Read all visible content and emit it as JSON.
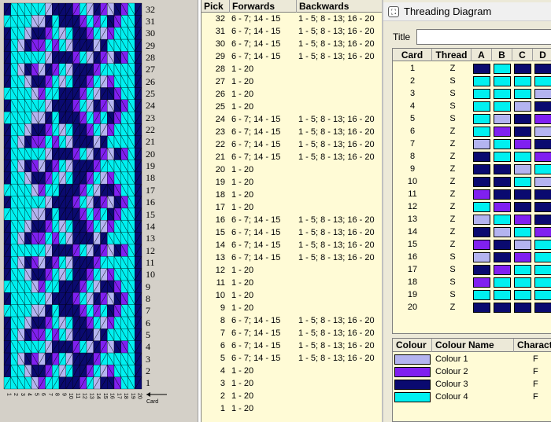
{
  "colours": [
    "#b4b4f0",
    "#8020f0",
    "#0a0a70",
    "#00f0f0"
  ],
  "pattern": {
    "pick_labels": [
      "32",
      "31",
      "30",
      "29",
      "28",
      "27",
      "26",
      "25",
      "24",
      "23",
      "22",
      "21",
      "20",
      "19",
      "18",
      "17",
      "16",
      "15",
      "14",
      "13",
      "12",
      "11",
      "10",
      "9",
      "8",
      "7",
      "6",
      "5",
      "4",
      "3",
      "2",
      "1"
    ],
    "card_labels": [
      "1",
      "2",
      "3",
      "4",
      "5",
      "6",
      "7",
      "8",
      "9",
      "10",
      "11",
      "12",
      "13",
      "14",
      "15",
      "16",
      "17",
      "18",
      "19",
      "20"
    ],
    "card_axis_label": "Card"
  },
  "pick_table": {
    "headers": {
      "pick": "Pick",
      "forwards": "Forwards",
      "backwards": "Backwards"
    },
    "rows": [
      {
        "pick": "32",
        "forwards": "6 - 7; 14 - 15",
        "backwards": "1 - 5; 8 - 13; 16 - 20"
      },
      {
        "pick": "31",
        "forwards": "6 - 7; 14 - 15",
        "backwards": "1 - 5; 8 - 13; 16 - 20"
      },
      {
        "pick": "30",
        "forwards": "6 - 7; 14 - 15",
        "backwards": "1 - 5; 8 - 13; 16 - 20"
      },
      {
        "pick": "29",
        "forwards": "6 - 7; 14 - 15",
        "backwards": "1 - 5; 8 - 13; 16 - 20"
      },
      {
        "pick": "28",
        "forwards": "1 - 20",
        "backwards": ""
      },
      {
        "pick": "27",
        "forwards": "1 - 20",
        "backwards": ""
      },
      {
        "pick": "26",
        "forwards": "1 - 20",
        "backwards": ""
      },
      {
        "pick": "25",
        "forwards": "1 - 20",
        "backwards": ""
      },
      {
        "pick": "24",
        "forwards": "6 - 7; 14 - 15",
        "backwards": "1 - 5; 8 - 13; 16 - 20"
      },
      {
        "pick": "23",
        "forwards": "6 - 7; 14 - 15",
        "backwards": "1 - 5; 8 - 13; 16 - 20"
      },
      {
        "pick": "22",
        "forwards": "6 - 7; 14 - 15",
        "backwards": "1 - 5; 8 - 13; 16 - 20"
      },
      {
        "pick": "21",
        "forwards": "6 - 7; 14 - 15",
        "backwards": "1 - 5; 8 - 13; 16 - 20"
      },
      {
        "pick": "20",
        "forwards": "1 - 20",
        "backwards": ""
      },
      {
        "pick": "19",
        "forwards": "1 - 20",
        "backwards": ""
      },
      {
        "pick": "18",
        "forwards": "1 - 20",
        "backwards": ""
      },
      {
        "pick": "17",
        "forwards": "1 - 20",
        "backwards": ""
      },
      {
        "pick": "16",
        "forwards": "6 - 7; 14 - 15",
        "backwards": "1 - 5; 8 - 13; 16 - 20"
      },
      {
        "pick": "15",
        "forwards": "6 - 7; 14 - 15",
        "backwards": "1 - 5; 8 - 13; 16 - 20"
      },
      {
        "pick": "14",
        "forwards": "6 - 7; 14 - 15",
        "backwards": "1 - 5; 8 - 13; 16 - 20"
      },
      {
        "pick": "13",
        "forwards": "6 - 7; 14 - 15",
        "backwards": "1 - 5; 8 - 13; 16 - 20"
      },
      {
        "pick": "12",
        "forwards": "1 - 20",
        "backwards": ""
      },
      {
        "pick": "11",
        "forwards": "1 - 20",
        "backwards": ""
      },
      {
        "pick": "10",
        "forwards": "1 - 20",
        "backwards": ""
      },
      {
        "pick": "9",
        "forwards": "1 - 20",
        "backwards": ""
      },
      {
        "pick": "8",
        "forwards": "6 - 7; 14 - 15",
        "backwards": "1 - 5; 8 - 13; 16 - 20"
      },
      {
        "pick": "7",
        "forwards": "6 - 7; 14 - 15",
        "backwards": "1 - 5; 8 - 13; 16 - 20"
      },
      {
        "pick": "6",
        "forwards": "6 - 7; 14 - 15",
        "backwards": "1 - 5; 8 - 13; 16 - 20"
      },
      {
        "pick": "5",
        "forwards": "6 - 7; 14 - 15",
        "backwards": "1 - 5; 8 - 13; 16 - 20"
      },
      {
        "pick": "4",
        "forwards": "1 - 20",
        "backwards": ""
      },
      {
        "pick": "3",
        "forwards": "1 - 20",
        "backwards": ""
      },
      {
        "pick": "2",
        "forwards": "1 - 20",
        "backwards": ""
      },
      {
        "pick": "1",
        "forwards": "1 - 20",
        "backwards": ""
      }
    ]
  },
  "threading_window": {
    "title": "Threading Diagram",
    "title_label": "Title",
    "title_value": "",
    "headers": {
      "card": "Card",
      "thread": "Thread",
      "a": "A",
      "b": "B",
      "c": "C",
      "d": "D"
    },
    "rows": [
      {
        "card": "1",
        "thread": "Z",
        "holes": [
          3,
          4,
          3,
          3
        ]
      },
      {
        "card": "2",
        "thread": "S",
        "holes": [
          4,
          4,
          4,
          4
        ]
      },
      {
        "card": "3",
        "thread": "S",
        "holes": [
          4,
          4,
          4,
          1
        ]
      },
      {
        "card": "4",
        "thread": "S",
        "holes": [
          4,
          4,
          1,
          3
        ]
      },
      {
        "card": "5",
        "thread": "S",
        "holes": [
          4,
          1,
          3,
          2
        ]
      },
      {
        "card": "6",
        "thread": "Z",
        "holes": [
          4,
          2,
          3,
          1
        ]
      },
      {
        "card": "7",
        "thread": "Z",
        "holes": [
          1,
          4,
          2,
          3
        ]
      },
      {
        "card": "8",
        "thread": "Z",
        "holes": [
          3,
          4,
          4,
          2
        ]
      },
      {
        "card": "9",
        "thread": "Z",
        "holes": [
          3,
          3,
          1,
          4
        ]
      },
      {
        "card": "10",
        "thread": "Z",
        "holes": [
          3,
          3,
          4,
          1
        ]
      },
      {
        "card": "11",
        "thread": "Z",
        "holes": [
          2,
          3,
          3,
          3
        ]
      },
      {
        "card": "12",
        "thread": "Z",
        "holes": [
          4,
          2,
          3,
          3
        ]
      },
      {
        "card": "13",
        "thread": "Z",
        "holes": [
          1,
          4,
          2,
          3
        ]
      },
      {
        "card": "14",
        "thread": "Z",
        "holes": [
          3,
          1,
          4,
          2
        ]
      },
      {
        "card": "15",
        "thread": "Z",
        "holes": [
          2,
          3,
          1,
          4
        ]
      },
      {
        "card": "16",
        "thread": "S",
        "holes": [
          1,
          3,
          2,
          4
        ]
      },
      {
        "card": "17",
        "thread": "S",
        "holes": [
          3,
          2,
          4,
          4
        ]
      },
      {
        "card": "18",
        "thread": "S",
        "holes": [
          2,
          4,
          4,
          4
        ]
      },
      {
        "card": "19",
        "thread": "S",
        "holes": [
          4,
          4,
          4,
          4
        ]
      },
      {
        "card": "20",
        "thread": "Z",
        "holes": [
          3,
          3,
          3,
          3
        ]
      }
    ],
    "colour_table": {
      "headers": {
        "colour": "Colour",
        "name": "Colour Name",
        "character": "Character"
      },
      "rows": [
        {
          "name": "Colour 1",
          "character": "F",
          "colour_index": 0
        },
        {
          "name": "Colour 2",
          "character": "F",
          "colour_index": 1
        },
        {
          "name": "Colour 3",
          "character": "F",
          "colour_index": 2
        },
        {
          "name": "Colour 4",
          "character": "F",
          "colour_index": 3
        }
      ]
    }
  }
}
